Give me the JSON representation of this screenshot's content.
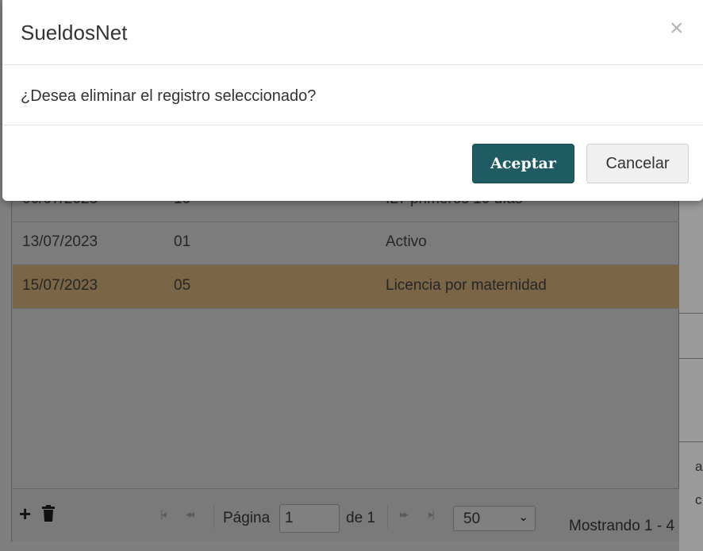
{
  "dialog": {
    "title": "SueldosNet",
    "close_glyph": "×",
    "message": "¿Desea eliminar el registro seleccionado?",
    "accept_label": "Aceptar",
    "cancel_label": "Cancelar",
    "accept_color": "#1f5b63"
  },
  "grid": {
    "rows": [
      {
        "date": "06/07/2023",
        "code": "10",
        "description": "ILT primeros 10 días"
      },
      {
        "date": "13/07/2023",
        "code": "01",
        "description": "Activo"
      },
      {
        "date": "15/07/2023",
        "code": "05",
        "description": "Licencia por maternidad",
        "selected": true
      }
    ],
    "selected_row_color": "#7a6647"
  },
  "pager": {
    "add_icon": "plus-icon",
    "delete_icon": "trash-icon",
    "page_label": "Página",
    "page_value": "1",
    "of_label": "de 1",
    "page_size": "50",
    "showing_text": "Mostrando 1 - 4"
  }
}
